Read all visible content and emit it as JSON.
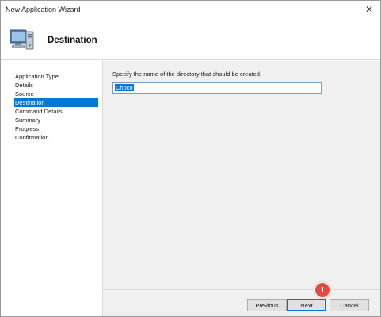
{
  "window": {
    "title": "New Application Wizard",
    "close_glyph": "✕"
  },
  "header": {
    "title": "Destination",
    "icon": "computer-icon"
  },
  "sidebar": {
    "items": [
      {
        "label": "Application Type",
        "active": false
      },
      {
        "label": "Details",
        "active": false
      },
      {
        "label": "Source",
        "active": false
      },
      {
        "label": "Destination",
        "active": true
      },
      {
        "label": "Command Details",
        "active": false
      },
      {
        "label": "Summary",
        "active": false
      },
      {
        "label": "Progress",
        "active": false
      },
      {
        "label": "Confirmation",
        "active": false
      }
    ]
  },
  "main": {
    "prompt": "Specify the name of the directory that should be created.",
    "directory_value": "Choco"
  },
  "footer": {
    "previous_label": "Previous",
    "next_label": "Next",
    "cancel_label": "Cancel"
  },
  "annotation": {
    "badge_number": "1",
    "color": "#e34b3d"
  },
  "colors": {
    "accent": "#0078d7",
    "panel_bg": "#f0f0f0"
  }
}
